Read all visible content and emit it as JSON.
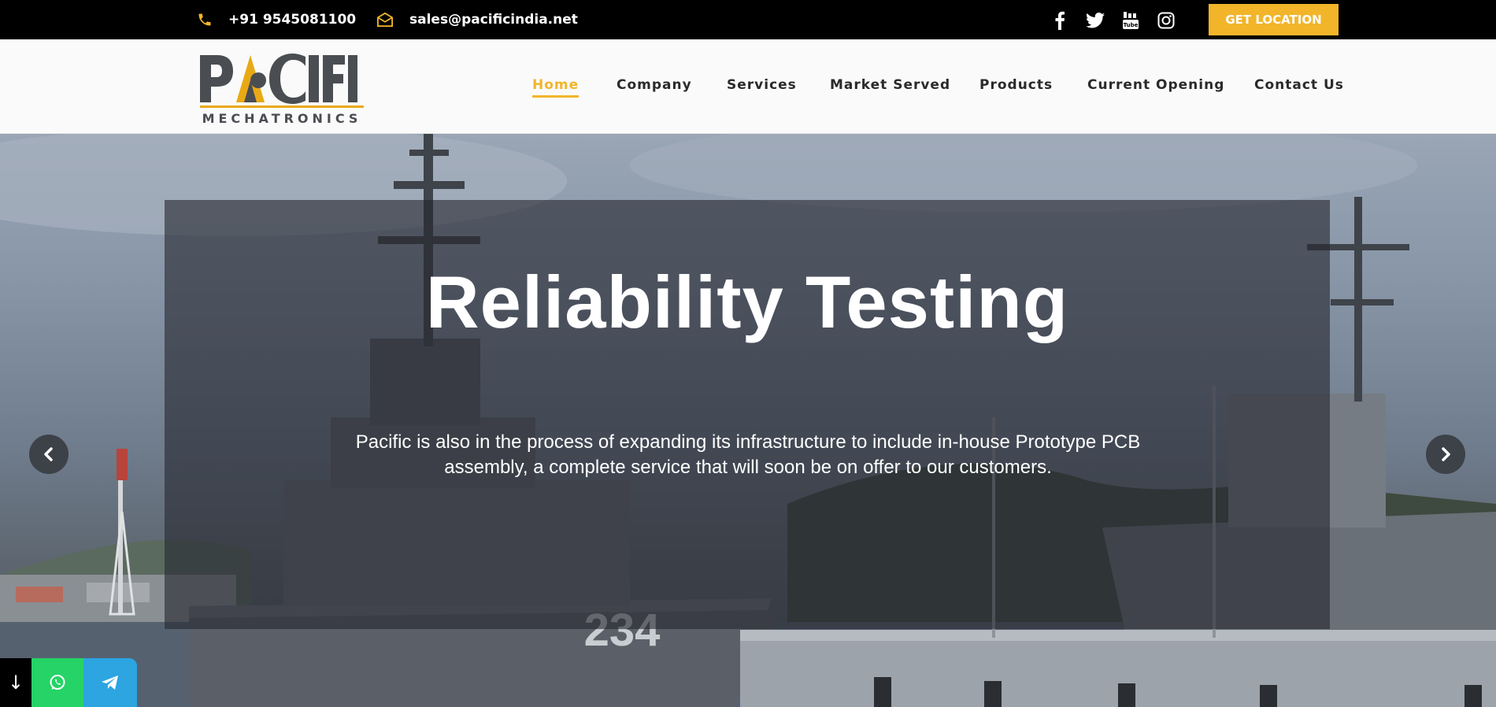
{
  "topbar": {
    "phone": "+91 9545081100",
    "email": "sales@pacificindia.net",
    "social_icons": [
      "facebook-icon",
      "twitter-icon",
      "youtube-icon",
      "instagram-icon"
    ],
    "cta_label": "GET LOCATION"
  },
  "logo": {
    "name": "PACIFIC",
    "tagline": "MECHATRONICS"
  },
  "nav": {
    "items": [
      {
        "label": "Home",
        "active": true
      },
      {
        "label": "Company",
        "active": false
      },
      {
        "label": "Services",
        "active": false
      },
      {
        "label": "Market Served",
        "active": false
      },
      {
        "label": "Products",
        "active": false
      },
      {
        "label": "Current Opening",
        "active": false
      },
      {
        "label": "Contact Us",
        "active": false
      }
    ]
  },
  "hero": {
    "title": "Reliability Testing",
    "text": "Pacific is also in the process of expanding its infrastructure to include in-house Prototype PCB assembly, a complete service that will soon be on offer to our customers.",
    "hull_number": "234"
  },
  "floating": {
    "scroll_glyph": "↓"
  },
  "colors": {
    "accent": "#f2b52a",
    "topbar_bg": "#000000",
    "whatsapp": "#25d366",
    "telegram": "#2ca5e0"
  }
}
